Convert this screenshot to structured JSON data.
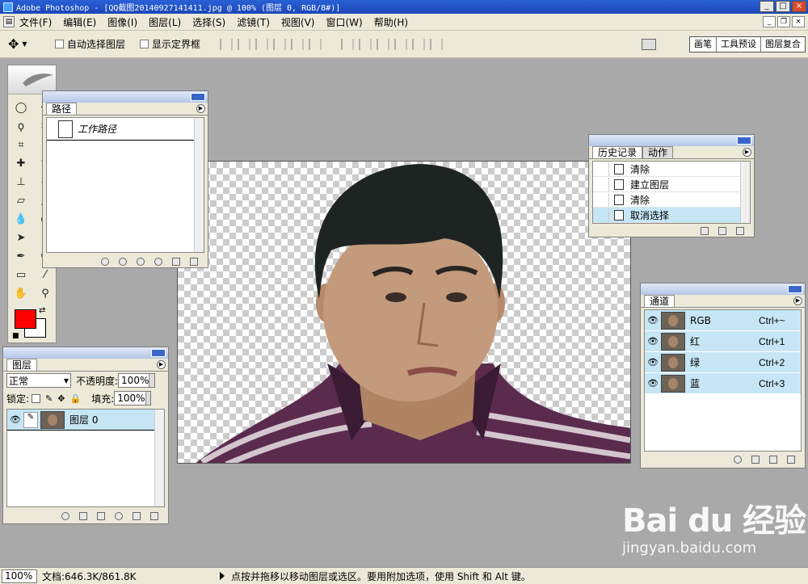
{
  "window": {
    "title": "Adobe Photoshop - [QQ截图20140927141411.jpg @ 100% (图层 0, RGB/8#)]",
    "buttons": [
      "_",
      "□",
      "×"
    ]
  },
  "menu": {
    "items": [
      "文件(F)",
      "编辑(E)",
      "图像(I)",
      "图层(L)",
      "选择(S)",
      "滤镜(T)",
      "视图(V)",
      "窗口(W)",
      "帮助(H)"
    ],
    "mdi_buttons": [
      "_",
      "❐",
      "×"
    ]
  },
  "options": {
    "auto_select_label": "自动选择图层",
    "show_bounds_label": "显示定界框",
    "palette_well_tabs": [
      "画笔",
      "工具预设",
      "图层复合"
    ]
  },
  "paths_panel": {
    "tab": "路径",
    "items": [
      {
        "name": "工作路径"
      }
    ]
  },
  "history_panel": {
    "tabs": [
      "历史记录",
      "动作"
    ],
    "items": [
      {
        "label": "清除",
        "selected": false
      },
      {
        "label": "建立图层",
        "selected": false
      },
      {
        "label": "清除",
        "selected": false
      },
      {
        "label": "取消选择",
        "selected": true
      }
    ]
  },
  "channels_panel": {
    "tab": "通道",
    "items": [
      {
        "name": "RGB",
        "shortcut": "Ctrl+~"
      },
      {
        "name": "红",
        "shortcut": "Ctrl+1"
      },
      {
        "name": "绿",
        "shortcut": "Ctrl+2"
      },
      {
        "name": "蓝",
        "shortcut": "Ctrl+3"
      }
    ]
  },
  "layers_panel": {
    "tab": "图层",
    "blend_mode": "正常",
    "opacity_label": "不透明度:",
    "opacity_value": "100%",
    "lock_label": "锁定:",
    "fill_label": "填充:",
    "fill_value": "100%",
    "layers": [
      {
        "name": "图层 0"
      }
    ]
  },
  "colors": {
    "foreground": "#ff0000",
    "background": "#ffffff",
    "selection": "#c6e6f5"
  },
  "status": {
    "zoom": "100%",
    "doc_info": "文档:646.3K/861.8K",
    "hint": "点按并拖移以移动图层或选区。要用附加选项，使用 Shift 和 Alt 键。"
  },
  "watermark": {
    "logo": "Bai du 经验",
    "url": "jingyan.baidu.com"
  }
}
